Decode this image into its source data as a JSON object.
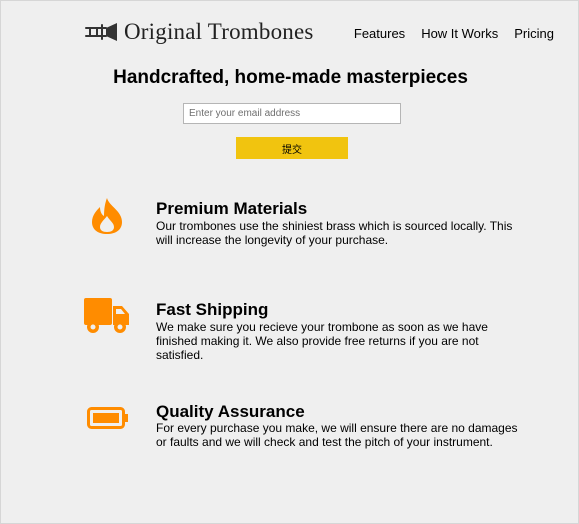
{
  "header": {
    "brand": "Original Trombones",
    "logo_icon": "trombone-icon",
    "nav": [
      {
        "label": "Features"
      },
      {
        "label": "How It Works"
      },
      {
        "label": "Pricing"
      }
    ]
  },
  "hero": {
    "title": "Handcrafted, home-made masterpieces",
    "email_placeholder": "Enter your email address",
    "submit_label": "提交"
  },
  "features": [
    {
      "icon": "fire-icon",
      "title": "Premium Materials",
      "description": "Our trombones use the shiniest brass which is sourced locally. This will increase the longevity of your purchase."
    },
    {
      "icon": "truck-icon",
      "title": "Fast Shipping",
      "description": "We make sure you recieve your trombone as soon as we have finished making it. We also provide free returns if you are not satisfied."
    },
    {
      "icon": "battery-icon",
      "title": "Quality Assurance",
      "description": "For every purchase you make, we will ensure there are no damages or faults and we will check and test the pitch of your instrument."
    }
  ],
  "colors": {
    "accent": "#f1c40f",
    "icon": "#ff8c00",
    "background": "#efefef"
  }
}
